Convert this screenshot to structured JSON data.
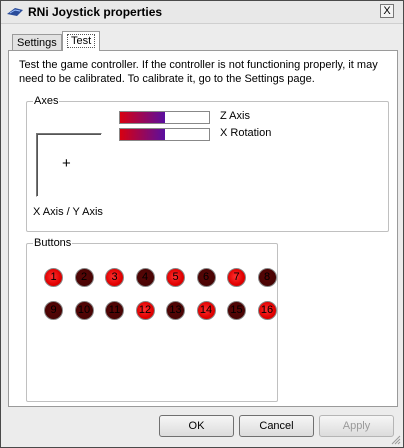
{
  "window": {
    "title": "RNi Joystick properties",
    "close_glyph": "X"
  },
  "tabs": [
    {
      "label": "Settings",
      "selected": false
    },
    {
      "label": "Test",
      "selected": true
    }
  ],
  "intro_text": "Test the game controller.  If the controller is not functioning properly, it may need to be calibrated.  To calibrate it, go to the Settings page.",
  "axes": {
    "group_label": "Axes",
    "xy_label": "X Axis / Y Axis",
    "cross_glyph": "+",
    "bars": [
      {
        "label": "Z Axis",
        "fill_fraction": 0.5
      },
      {
        "label": "X Rotation",
        "fill_fraction": 0.5
      }
    ]
  },
  "buttons_group": {
    "label": "Buttons",
    "items": [
      {
        "label": "1",
        "pressed": false
      },
      {
        "label": "2",
        "pressed": true
      },
      {
        "label": "3",
        "pressed": false
      },
      {
        "label": "4",
        "pressed": true
      },
      {
        "label": "5",
        "pressed": false
      },
      {
        "label": "6",
        "pressed": true
      },
      {
        "label": "7",
        "pressed": false
      },
      {
        "label": "8",
        "pressed": true
      },
      {
        "label": "9",
        "pressed": true
      },
      {
        "label": "10",
        "pressed": true
      },
      {
        "label": "11",
        "pressed": true
      },
      {
        "label": "12",
        "pressed": false
      },
      {
        "label": "13",
        "pressed": true
      },
      {
        "label": "14",
        "pressed": false
      },
      {
        "label": "15",
        "pressed": true
      },
      {
        "label": "16",
        "pressed": false
      }
    ]
  },
  "dialog_buttons": {
    "ok": "OK",
    "cancel": "Cancel",
    "apply": "Apply"
  },
  "colors": {
    "active_button": "#e00000",
    "inactive_button": "#4a0404",
    "bar_start": "#d70010",
    "bar_end": "#5a0fa0"
  }
}
